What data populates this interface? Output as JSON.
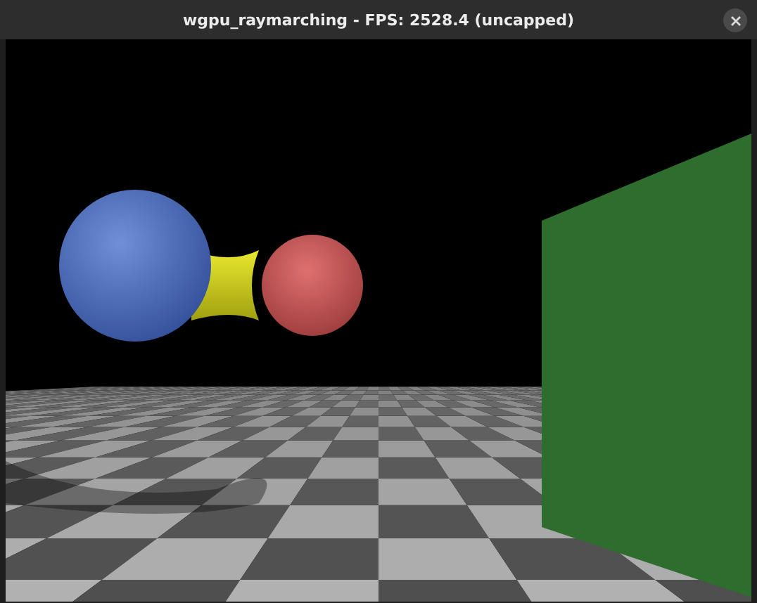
{
  "window": {
    "title": "wgpu_raymarching - FPS: 2528.4 (uncapped)"
  }
}
